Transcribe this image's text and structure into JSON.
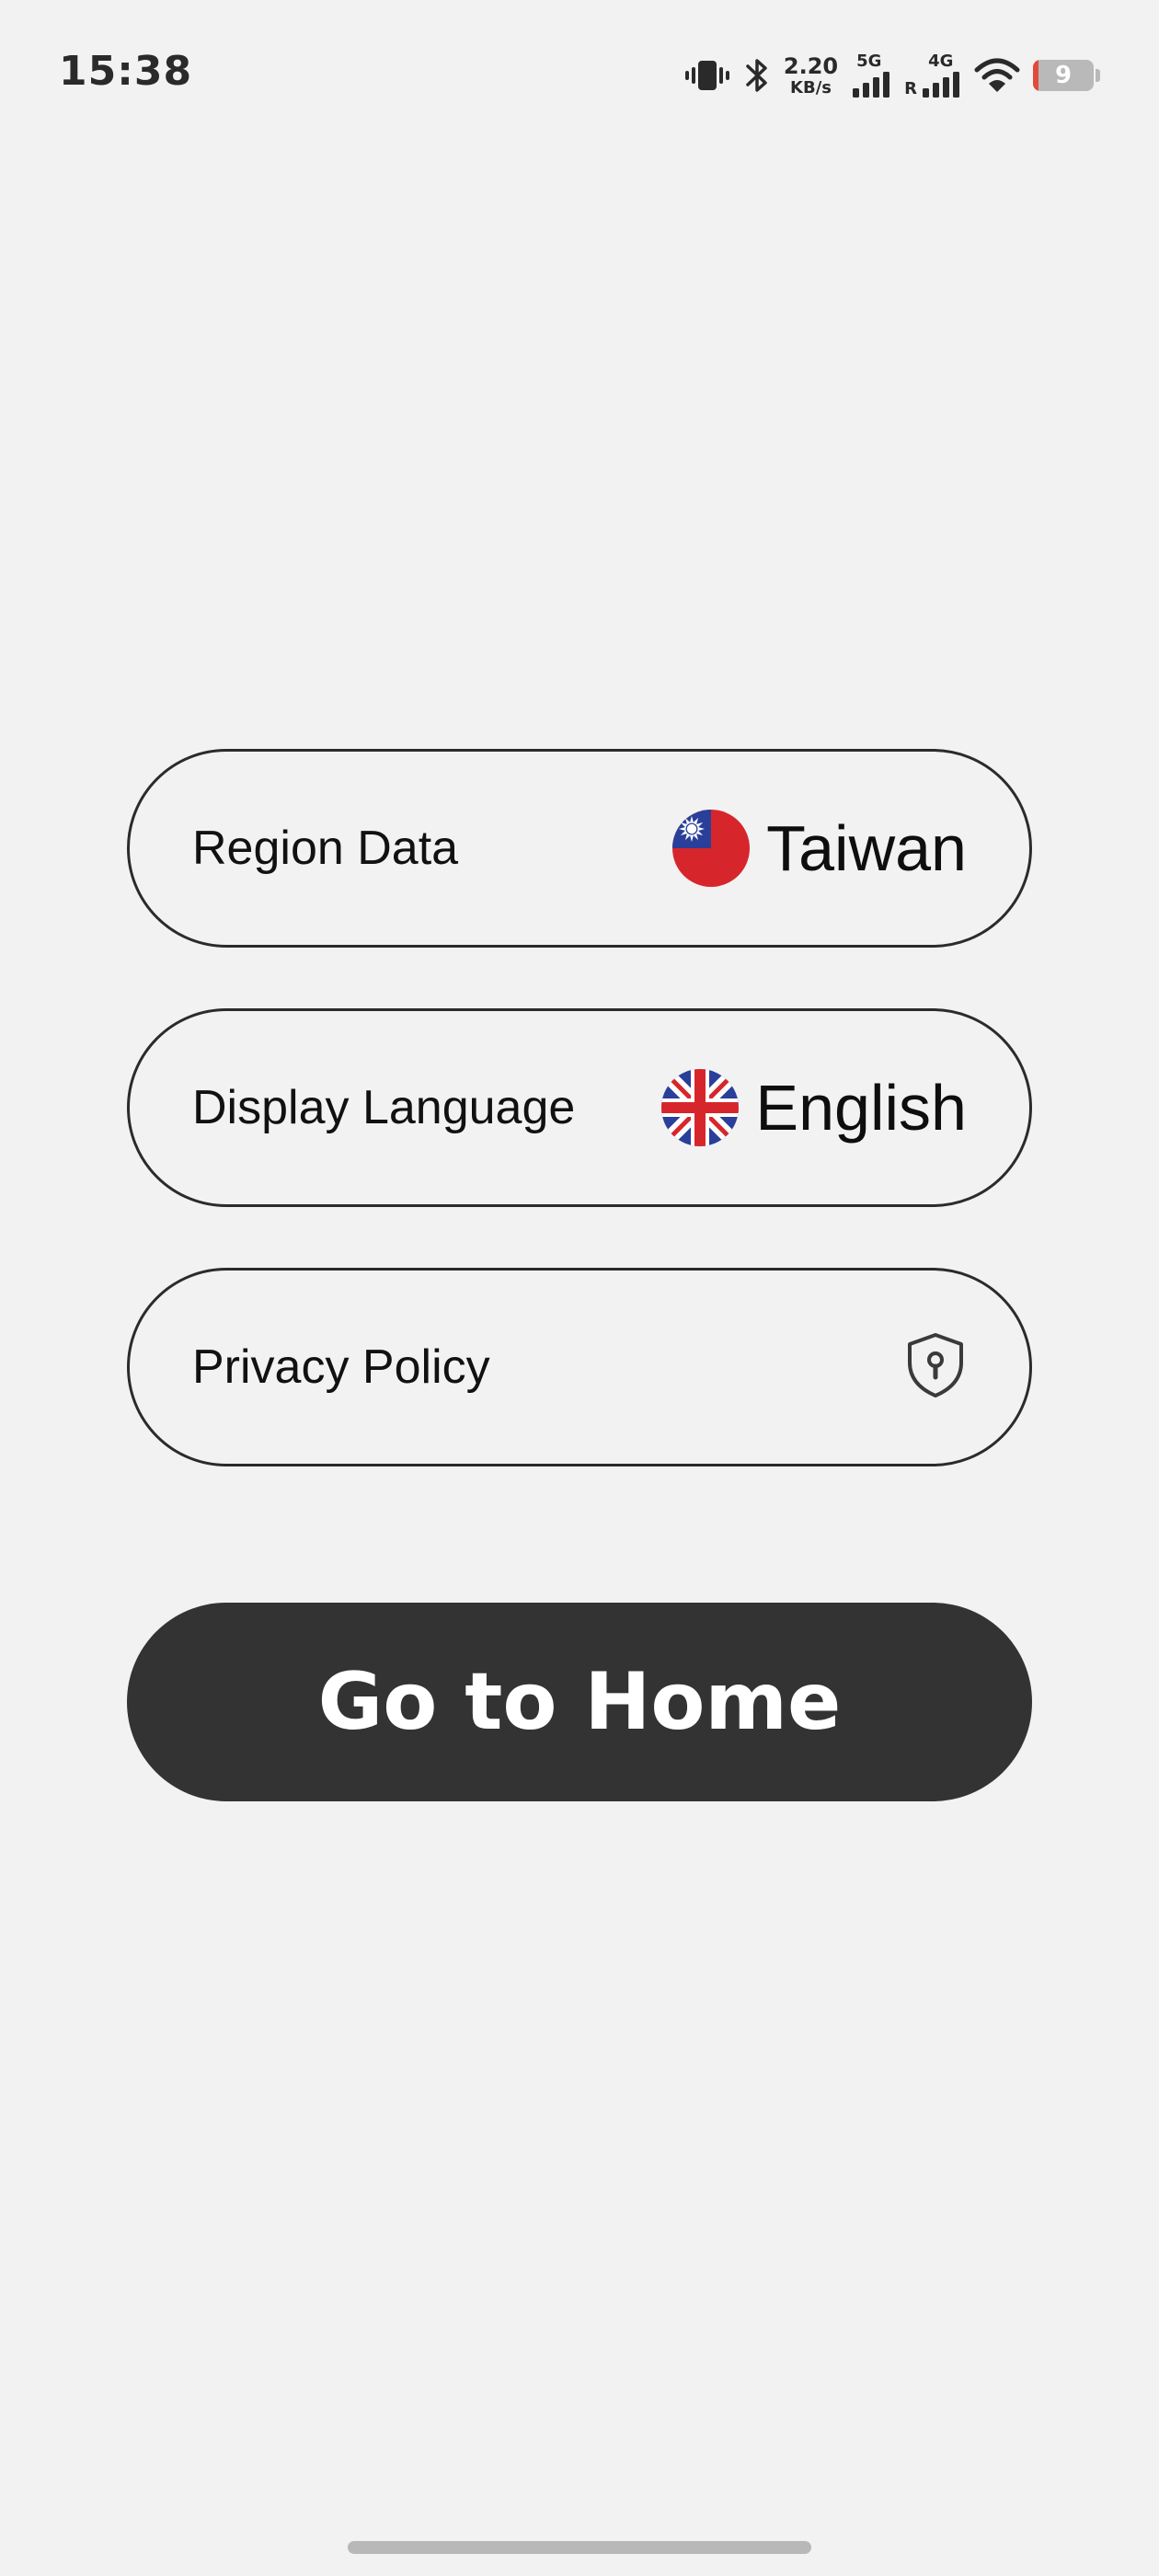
{
  "status_bar": {
    "time": "15:38",
    "net_speed_value": "2.20",
    "net_speed_unit": "KB/s",
    "network_type_1": "5G",
    "network_type_2": "4G",
    "roaming": "R",
    "battery_level": "9",
    "battery_fraction": 0.09,
    "icons": [
      "vibrate-icon",
      "bluetooth-icon",
      "signal-5g-icon",
      "signal-4g-icon",
      "wifi-icon",
      "battery-icon"
    ]
  },
  "settings": {
    "region": {
      "label": "Region Data",
      "value": "Taiwan",
      "icon": "taiwan-flag-icon"
    },
    "language": {
      "label": "Display Language",
      "value": "English",
      "icon": "uk-flag-icon"
    },
    "privacy": {
      "label": "Privacy Policy",
      "icon": "shield-lock-icon"
    }
  },
  "primary_button": {
    "label": "Go to Home"
  },
  "colors": {
    "background": "#f2f2f2",
    "pill_border": "#2b2b2b",
    "button_bg": "#333333",
    "button_text": "#ffffff",
    "battery_low": "#e04a3c"
  }
}
